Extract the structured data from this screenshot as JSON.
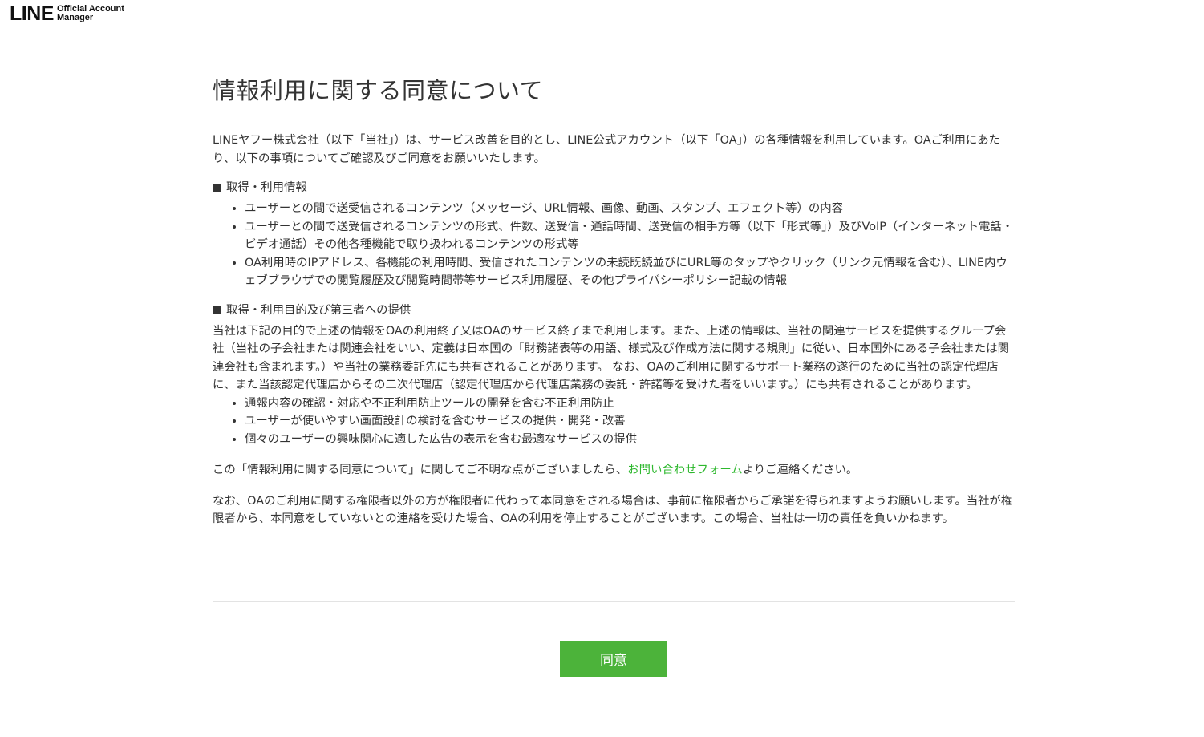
{
  "header": {
    "logo_main": "LINE",
    "logo_sub_line1": "Official Account",
    "logo_sub_line2": "Manager"
  },
  "page": {
    "title": "情報利用に関する同意について",
    "intro": "LINEヤフー株式会社（以下「当社」）は、サービス改善を目的とし、LINE公式アカウント（以下「OA」）の各種情報を利用しています。OAご利用にあたり、以下の事項についてご確認及びご同意をお願いいたします。",
    "section1": {
      "heading": "取得・利用情報",
      "items": [
        "ユーザーとの間で送受信されるコンテンツ（メッセージ、URL情報、画像、動画、スタンプ、エフェクト等）の内容",
        "ユーザーとの間で送受信されるコンテンツの形式、件数、送受信・通話時間、送受信の相手方等（以下「形式等」）及びVoIP（インターネット電話・ビデオ通話）その他各種機能で取り扱われるコンテンツの形式等",
        "OA利用時のIPアドレス、各機能の利用時間、受信されたコンテンツの未読既読並びにURL等のタップやクリック（リンク元情報を含む）、LINE内ウェブブラウザでの閲覧履歴及び閲覧時間帯等サービス利用履歴、その他プライバシーポリシー記載の情報"
      ]
    },
    "section2": {
      "heading": "取得・利用目的及び第三者への提供",
      "paragraph": "当社は下記の目的で上述の情報をOAの利用終了又はOAのサービス終了まで利用します。また、上述の情報は、当社の関連サービスを提供するグループ会社（当社の子会社または関連会社をいい、定義は日本国の「財務諸表等の用語、様式及び作成方法に関する規則」に従い、日本国外にある子会社または関連会社も含まれます。）や当社の業務委託先にも共有されることがあります。 なお、OAのご利用に関するサポート業務の遂行のために当社の認定代理店に、また当該認定代理店からその二次代理店（認定代理店から代理店業務の委託・許諾等を受けた者をいいます。）にも共有されることがあります。",
      "items": [
        "通報内容の確認・対応や不正利用防止ツールの開発を含む不正利用防止",
        "ユーザーが使いやすい画面設計の検討を含むサービスの提供・開発・改善",
        "個々のユーザーの興味関心に適した広告の表示を含む最適なサービスの提供"
      ]
    },
    "contact_before": "この「情報利用に関する同意について」に関してご不明な点がございましたら、",
    "contact_link": "お問い合わせフォーム",
    "contact_after": "よりご連絡ください。",
    "note": "なお、OAのご利用に関する権限者以外の方が権限者に代わって本同意をされる場合は、事前に権限者からご承諾を得られますようお願いします。当社が権限者から、本同意をしていないとの連絡を受けた場合、OAの利用を停止することがございます。この場合、当社は一切の責任を負いかねます。",
    "agree_label": "同意"
  },
  "colors": {
    "accent_green": "#4cb33a",
    "link_green": "#2eb82e",
    "text": "#333333"
  }
}
